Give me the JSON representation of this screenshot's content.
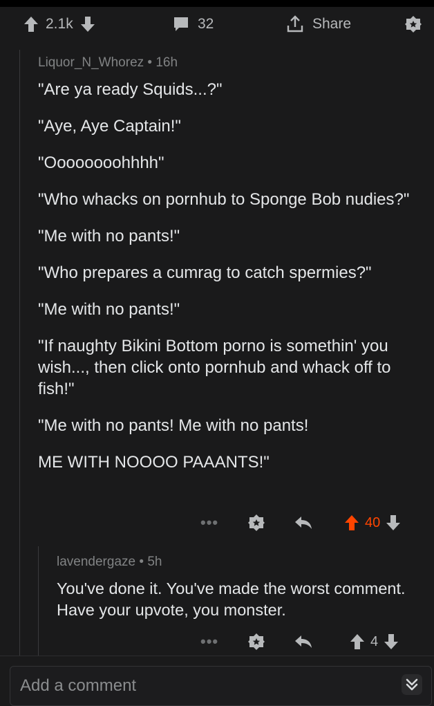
{
  "post_bar": {
    "vote_count": "2.1k",
    "comment_count": "32",
    "share_label": "Share"
  },
  "comments": [
    {
      "author": "Liquor_N_Whorez",
      "time": "16h",
      "paragraphs": [
        "\"Are ya ready Squids...?\"",
        "\"Aye, Aye Captain!\"",
        "\"Oooooooohhhh\"",
        "\"Who whacks on pornhub to Sponge Bob nudies?\"",
        "\"Me with no pants!\"",
        "\"Who prepares a cumrag to catch spermies?\"",
        "\"Me with no pants!\"",
        "\"If naughty Bikini Bottom porno is somethin' you wish..., then click onto pornhub and whack off to fish!\"",
        "\"Me with no pants! Me with no pants!",
        "ME WITH NOOOO PAAANTS!\""
      ],
      "vote_count": "40",
      "upvoted": true
    },
    {
      "author": "lavendergaze",
      "time": "5h",
      "paragraphs": [
        "You've done it. You've made the worst comment. Have your upvote, you monster."
      ],
      "vote_count": "4",
      "upvoted": false
    }
  ],
  "composer": {
    "placeholder": "Add a comment"
  },
  "icons": {
    "more": "more-dots-icon",
    "award": "award-icon",
    "reply": "reply-icon",
    "upvote": "upvote-arrow-icon",
    "downvote": "downvote-arrow-icon",
    "collapse": "double-chevron-down-icon"
  },
  "colors": {
    "background": "#1a1a1b",
    "text": "#e4e6e8",
    "muted": "#818384",
    "upvote_active": "#ff4500"
  }
}
